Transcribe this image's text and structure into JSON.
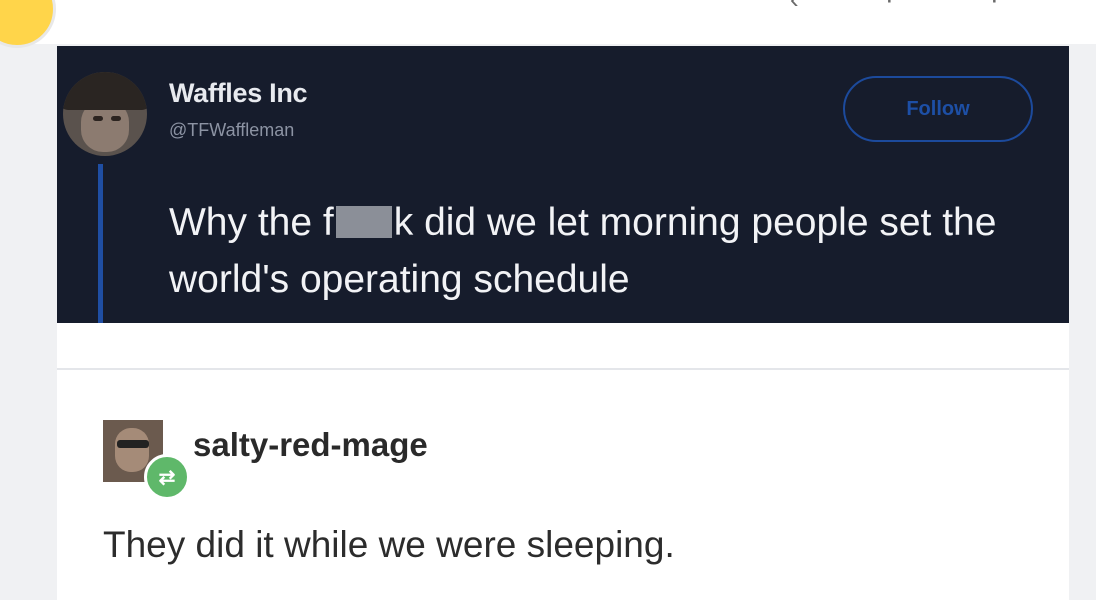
{
  "tweet": {
    "display_name": "Waffles Inc",
    "handle": "@TFWaffleman",
    "follow_label": "Follow",
    "text_before_censor": "Why the f",
    "text_after_censor": "k did we let morning people set the world's operating schedule"
  },
  "reply": {
    "username": "salty-red-mage",
    "text": "They did it while we were sleeping.",
    "reblog_icon": "reblog-icon"
  },
  "colors": {
    "tweet_background": "#161c2c",
    "follow_accent": "#1d4fa6",
    "reblog_badge": "#5fb86a"
  }
}
